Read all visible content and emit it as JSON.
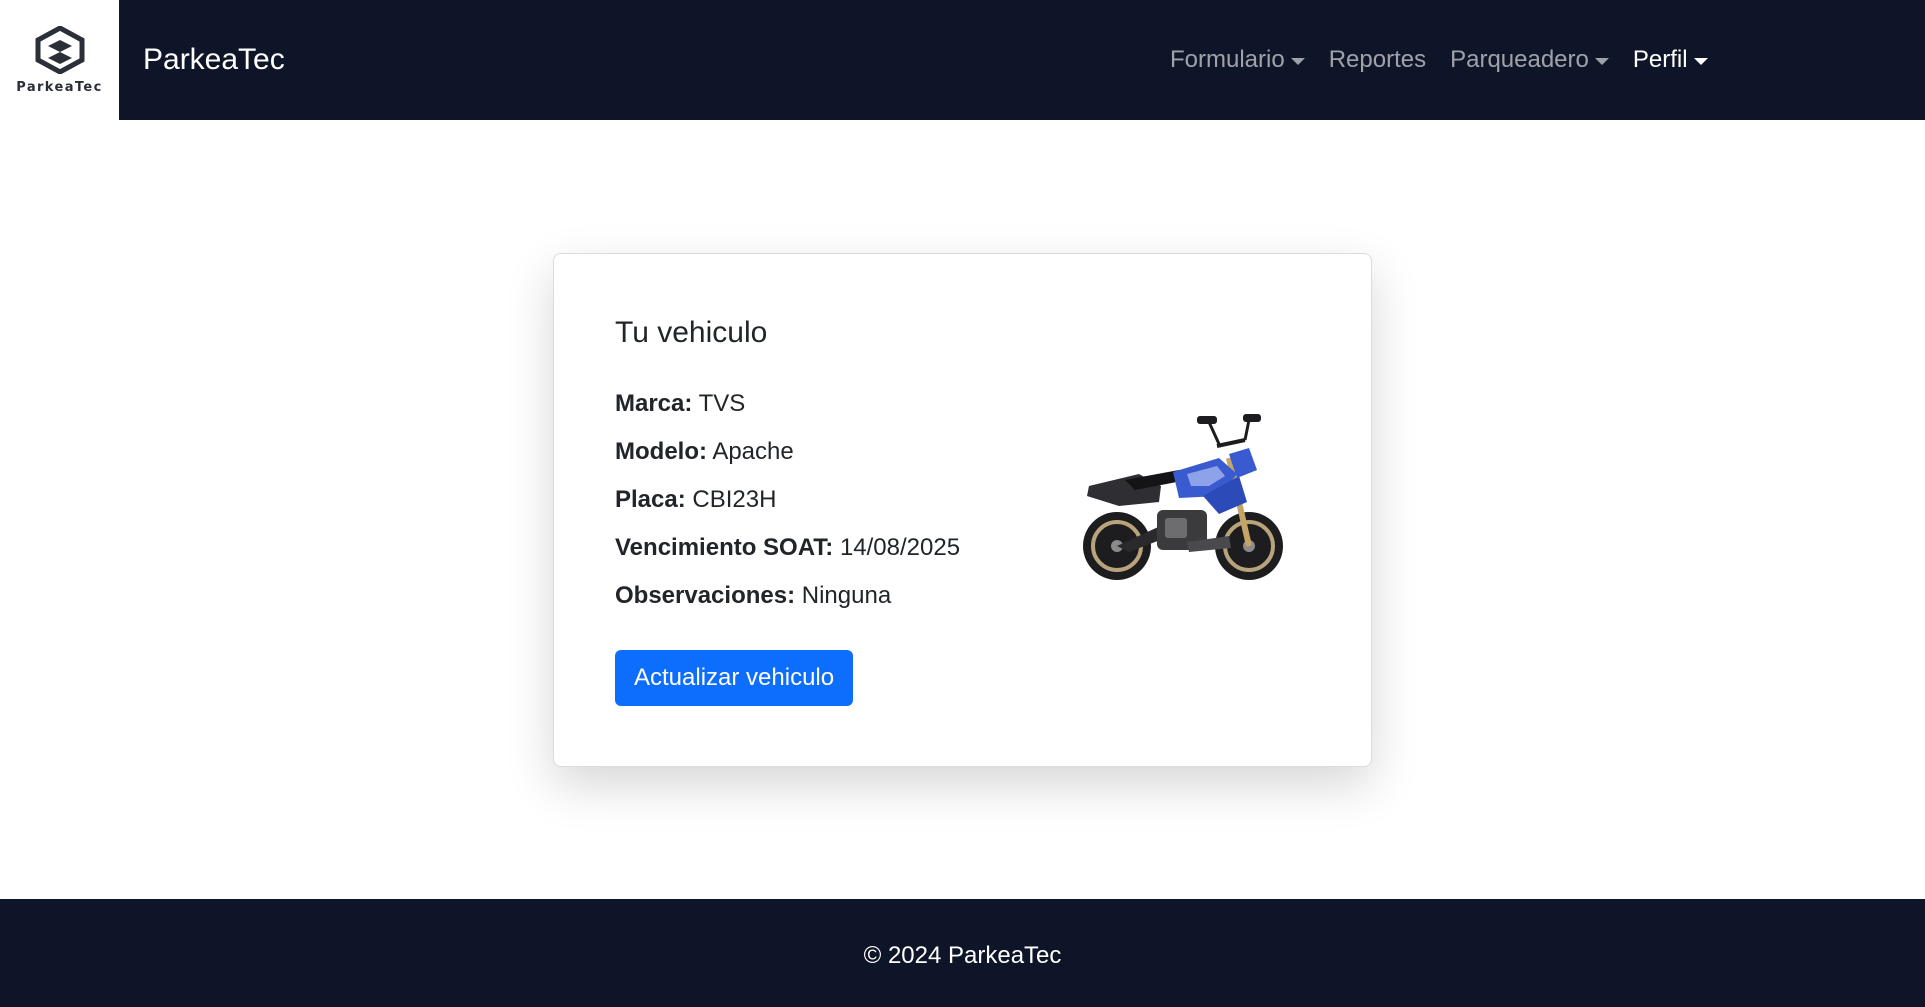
{
  "navbar": {
    "logo_text": "ParkeaTec",
    "brand": "ParkeaTec",
    "items": [
      {
        "label": "Formulario",
        "dropdown": true
      },
      {
        "label": "Reportes",
        "dropdown": false
      },
      {
        "label": "Parqueadero",
        "dropdown": true
      },
      {
        "label": "Perfil",
        "dropdown": true
      }
    ]
  },
  "card": {
    "title": "Tu vehiculo",
    "fields": [
      {
        "label": "Marca:",
        "value": "TVS"
      },
      {
        "label": "Modelo:",
        "value": "Apache"
      },
      {
        "label": "Placa:",
        "value": "CBI23H"
      },
      {
        "label": "Vencimiento SOAT:",
        "value": "14/08/2025"
      },
      {
        "label": "Observaciones:",
        "value": "Ninguna"
      }
    ],
    "button_label": "Actualizar vehiculo",
    "image_icon": "motorcycle-image"
  },
  "footer": {
    "text": "© 2024 ParkeaTec"
  },
  "colors": {
    "navbar_bg": "#0f1528",
    "primary": "#0d6efd",
    "bike_blue": "#3a5bd0"
  }
}
